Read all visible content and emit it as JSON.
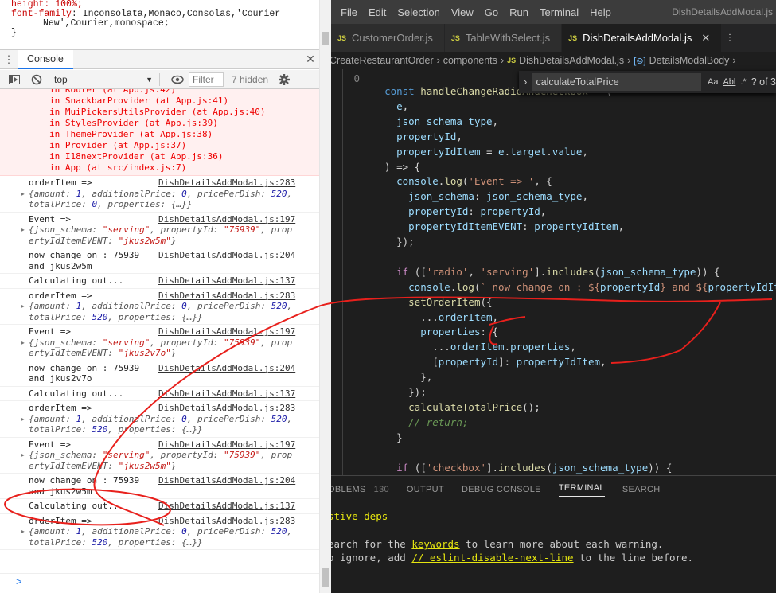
{
  "devtools": {
    "css_lines": [
      "height: 100%;",
      "font-family: Inconsolata,Monaco,Consolas,'Courier",
      "New',Courier,monospace;",
      "}"
    ],
    "drawer_tab": "Console",
    "context": "top",
    "filter_placeholder": "Filter",
    "hidden_count": "7 hidden",
    "error_stack": [
      "in Router (at App.js:42)",
      "in SnackbarProvider (at App.js:41)",
      "in MuiPickersUtilsProvider (at App.js:40)",
      "in StylesProvider (at App.js:39)",
      "in ThemeProvider (at App.js:38)",
      "in Provider (at App.js:37)",
      "in I18nextProvider (at App.js:36)",
      "in App (at src/index.js:7)"
    ],
    "messages": [
      {
        "kind": "order",
        "label": "orderItem =>",
        "src": "DishDetailsAddModal.js:283",
        "line1": "{amount: 1, additionalPrice: 0, pricePerDish: 520,",
        "line2": "totalPrice: 0, properties: {…}}"
      },
      {
        "kind": "event",
        "label": "Event =>",
        "src": "DishDetailsAddModal.js:197",
        "line1": "{json_schema: \"serving\", propertyId: \"75939\", prop",
        "line2": "ertyIdItemEVENT: \"jkus2w5m\"}"
      },
      {
        "kind": "text",
        "label": "now change on : 75939",
        "src": "DishDetailsAddModal.js:204",
        "line1": "and jkus2w5m"
      },
      {
        "kind": "plain",
        "label": "Calculating out...",
        "src": "DishDetailsAddModal.js:137"
      },
      {
        "kind": "order",
        "label": "orderItem =>",
        "src": "DishDetailsAddModal.js:283",
        "line1": "{amount: 1, additionalPrice: 0, pricePerDish: 520,",
        "line2": "totalPrice: 520, properties: {…}}"
      },
      {
        "kind": "event",
        "label": "Event =>",
        "src": "DishDetailsAddModal.js:197",
        "line1": "{json_schema: \"serving\", propertyId: \"75939\", prop",
        "line2": "ertyIdItemEVENT: \"jkus2v7o\"}"
      },
      {
        "kind": "text",
        "label": "now change on : 75939",
        "src": "DishDetailsAddModal.js:204",
        "line1": "and jkus2v7o"
      },
      {
        "kind": "plain",
        "label": "Calculating out...",
        "src": "DishDetailsAddModal.js:137"
      },
      {
        "kind": "order",
        "label": "orderItem =>",
        "src": "DishDetailsAddModal.js:283",
        "line1": "{amount: 1, additionalPrice: 0, pricePerDish: 520,",
        "line2": "totalPrice: 520, properties: {…}}"
      },
      {
        "kind": "event",
        "label": "Event =>",
        "src": "DishDetailsAddModal.js:197",
        "line1": "{json_schema: \"serving\", propertyId: \"75939\", prop",
        "line2": "ertyIdItemEVENT: \"jkus2w5m\"}"
      },
      {
        "kind": "text",
        "label": "now change on : 75939",
        "src": "DishDetailsAddModal.js:204",
        "line1": "and jkus2w5m"
      },
      {
        "kind": "plain",
        "label": "Calculating out...",
        "src": "DishDetailsAddModal.js:137"
      },
      {
        "kind": "order",
        "label": "orderItem =>",
        "src": "DishDetailsAddModal.js:283",
        "line1": "{amount: 1, additionalPrice: 0, pricePerDish: 520,",
        "line2": "totalPrice: 520, properties: {…}}"
      }
    ],
    "prompt": ">"
  },
  "editor": {
    "menu": [
      "File",
      "Edit",
      "Selection",
      "View",
      "Go",
      "Run",
      "Terminal",
      "Help"
    ],
    "window_title": "DishDetailsAddModal.js",
    "tabs": [
      {
        "icon": "JS",
        "label": "CustomerOrder.js",
        "active": false
      },
      {
        "icon": "JS",
        "label": "TableWithSelect.js",
        "active": false
      },
      {
        "icon": "JS",
        "label": "DishDetailsAddModal.js",
        "active": true
      }
    ],
    "breadcrumbs": [
      "CreateRestaurantOrder",
      "components",
      "DishDetailsAddModal.js",
      "DetailsModalBody"
    ],
    "find": {
      "query": "calculateTotalPrice",
      "opt_case": "Aa",
      "opt_word": "Abl",
      "opt_regex": ".*",
      "count": "? of 3"
    },
    "line_number_top": "0",
    "code_lines": [
      "  const handleChangeRadioAndCheckbox = (",
      "    e,",
      "    json_schema_type,",
      "    propertyId,",
      "    propertyIdItem = e.target.value,",
      "  ) => {",
      "    console.log('Event => ', {",
      "      json_schema: json_schema_type,",
      "      propertyId: propertyId,",
      "      propertyIdItemEVENT: propertyIdItem,",
      "    });",
      "",
      "    if (['radio', 'serving'].includes(json_schema_type)) {",
      "      console.log(` now change on : ${propertyId} and ${propertyIdItem}`);",
      "      setOrderItem({",
      "        ...orderItem,",
      "        properties: {",
      "          ...orderItem.properties,",
      "          [propertyId]: propertyIdItem,",
      "        },",
      "      });",
      "      calculateTotalPrice();",
      "      // return;",
      "    }",
      "",
      "    if (['checkbox'].includes(json_schema_type)) {"
    ],
    "panel_tabs": [
      "OBLEMS",
      "130",
      "OUTPUT",
      "DEBUG CONSOLE",
      "TERMINAL",
      "SEARCH"
    ],
    "terminal": {
      "line1": "stive-deps",
      "line2_a": "earch for the ",
      "line2_kw": "keywords",
      "line2_b": " to learn more about each warning.",
      "line3_a": "o ignore, add ",
      "line3_kw": "// eslint-disable-next-line",
      "line3_b": " to the line before."
    }
  },
  "annotation_color": "#e8201c"
}
